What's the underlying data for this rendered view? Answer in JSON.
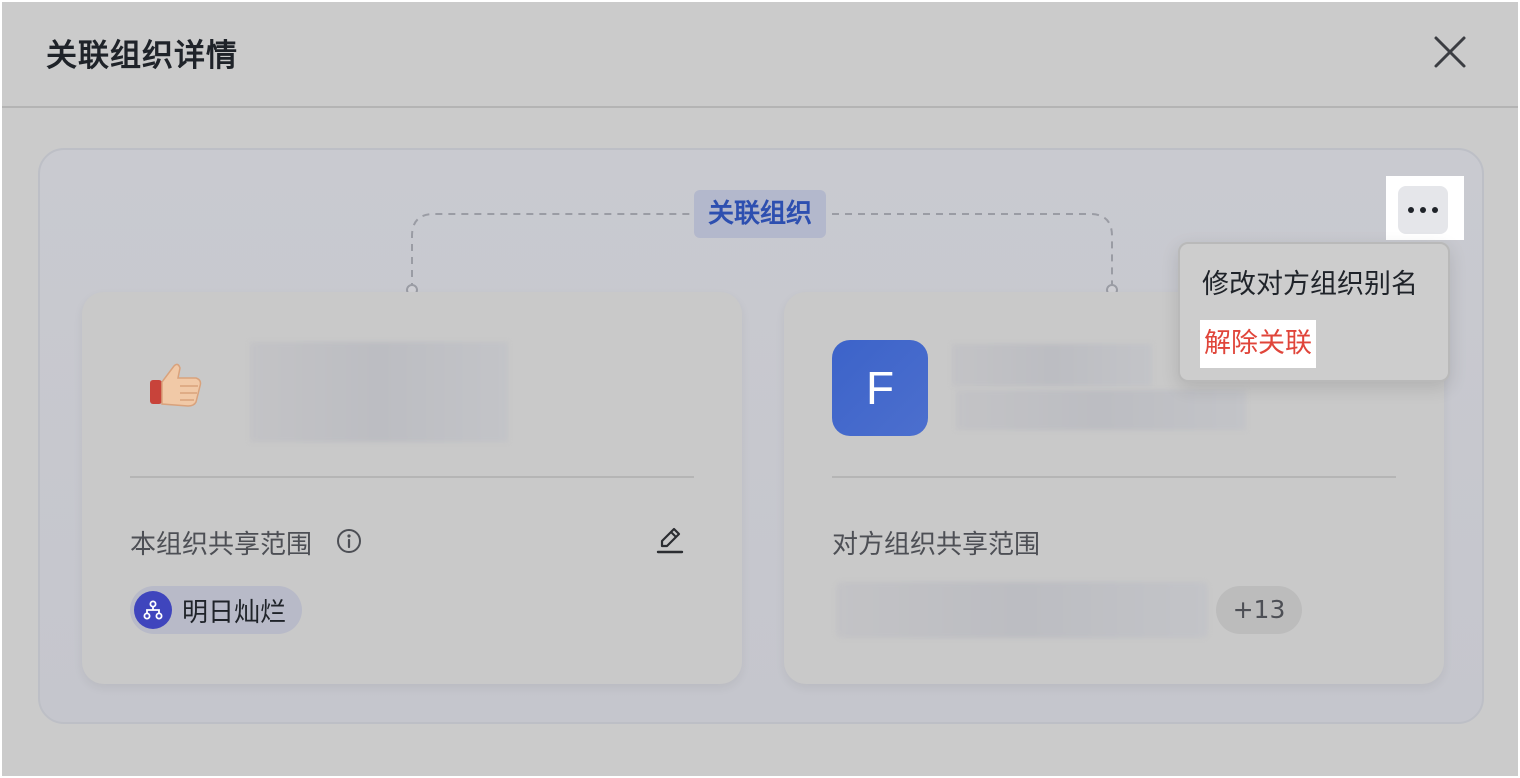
{
  "dialog": {
    "title": "关联组织详情",
    "close_icon": "close-icon"
  },
  "relation": {
    "label": "关联组织"
  },
  "own_org": {
    "logo_icon": "thumbs-up-icon",
    "scope_label": "本组织共享范围",
    "info_icon": "info-icon",
    "edit_icon": "edit-icon",
    "scope_chip": {
      "icon": "org-structure-icon",
      "label": "明日灿烂"
    }
  },
  "partner_org": {
    "avatar_letter": "F",
    "scope_label": "对方组织共享范围",
    "more_count": "+13"
  },
  "more_menu": {
    "icon": "more-icon",
    "items": [
      {
        "label": "修改对方组织别名"
      },
      {
        "label": "解除关联",
        "color": "#e0453a"
      }
    ]
  },
  "colors": {
    "accent": "#3c63c9",
    "danger": "#e0453a",
    "chip_icon_bg": "#3f45bd"
  }
}
